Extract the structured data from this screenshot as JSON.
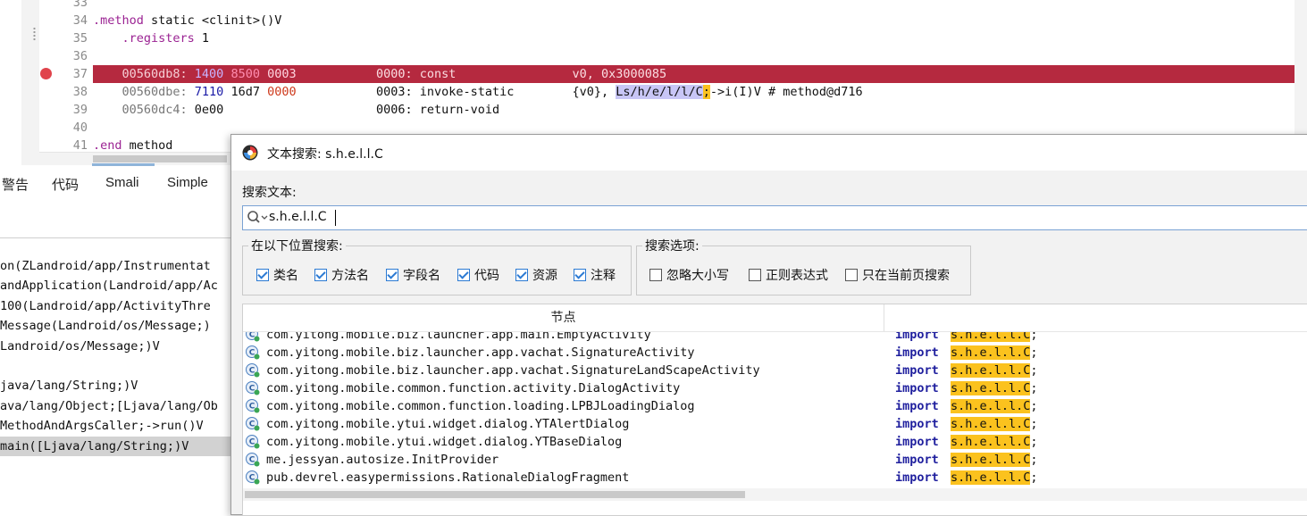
{
  "editor": {
    "lines": [
      {
        "num": "33",
        "parts": []
      },
      {
        "num": "34",
        "parts": [
          {
            "t": ".method",
            "c": "kw"
          },
          {
            "t": " static <clinit>()V",
            "c": ""
          }
        ]
      },
      {
        "num": "35",
        "parts": [
          {
            "t": "    .registers",
            "c": "kw"
          },
          {
            "t": " 1",
            "c": ""
          }
        ]
      },
      {
        "num": "36",
        "parts": []
      },
      {
        "num": "37",
        "highlight": true,
        "parts": [
          {
            "t": "    00560db8: ",
            "c": "addr"
          },
          {
            "t": "1400",
            "c": "hx1"
          },
          {
            "t": " ",
            "c": ""
          },
          {
            "t": "8500",
            "c": "hx2"
          },
          {
            "t": " ",
            "c": ""
          },
          {
            "t": "0003",
            "c": "hx3"
          },
          {
            "t": "           0000: const                v0, 0x3000085",
            "c": ""
          }
        ]
      },
      {
        "num": "38",
        "parts": [
          {
            "t": "    00560dbe: ",
            "c": "addr"
          },
          {
            "t": "7110",
            "c": "hx1"
          },
          {
            "t": " 16d7 ",
            "c": ""
          },
          {
            "t": "0000",
            "c": "hx2"
          },
          {
            "t": "           0003: invoke-static        {v0}, ",
            "c": ""
          },
          {
            "t": "Ls/h/e/l/l/C",
            "c": "mark-purple"
          },
          {
            "t": ";",
            "c": "mark-yellow"
          },
          {
            "t": "->i(I)V # method@d716",
            "c": ""
          }
        ]
      },
      {
        "num": "39",
        "parts": [
          {
            "t": "    00560dc4: ",
            "c": "addr"
          },
          {
            "t": "0e00",
            "c": ""
          },
          {
            "t": "                     0006: return-void",
            "c": ""
          }
        ]
      },
      {
        "num": "40",
        "parts": []
      },
      {
        "num": "41",
        "parts": [
          {
            "t": ".end",
            "c": "kw"
          },
          {
            "t": " method",
            "c": ""
          }
        ]
      }
    ]
  },
  "tabs": [
    "警告",
    "代码",
    "Smali",
    "Simple"
  ],
  "stack_lines": [
    "on(ZLandroid/app/Instrumentat",
    "andApplication(Landroid/app/Ac",
    "100(Landroid/app/ActivityThre",
    "Message(Landroid/os/Message;)",
    "Landroid/os/Message;)V",
    "",
    "java/lang/String;)V",
    "ava/lang/Object;[Ljava/lang/Ob",
    "MethodAndArgsCaller;->run()V",
    "main([Ljava/lang/String;)V"
  ],
  "dialog": {
    "title": "文本搜索: s.h.e.l.l.C",
    "search_label": "搜索文本:",
    "search_value": "s.h.e.l.l.C",
    "where_group_title": "在以下位置搜索:",
    "where_options": [
      {
        "label": "类名",
        "checked": true
      },
      {
        "label": "方法名",
        "checked": true
      },
      {
        "label": "字段名",
        "checked": true
      },
      {
        "label": "代码",
        "checked": true
      },
      {
        "label": "资源",
        "checked": true
      },
      {
        "label": "注释",
        "checked": true
      }
    ],
    "options_group_title": "搜索选项:",
    "search_options": [
      {
        "label": "忽略大小写",
        "checked": false
      },
      {
        "label": "正则表达式",
        "checked": false
      },
      {
        "label": "只在当前页搜索",
        "checked": false
      }
    ],
    "results": {
      "column_node": "节点",
      "rows": [
        {
          "node": "com.yitong.mobile.biz.launcher.app.main.EmptyActivity",
          "kw": "import",
          "match": "s.h.e.l.l.C",
          "tail": ";"
        },
        {
          "node": "com.yitong.mobile.biz.launcher.app.vachat.SignatureActivity",
          "kw": "import",
          "match": "s.h.e.l.l.C",
          "tail": ";"
        },
        {
          "node": "com.yitong.mobile.biz.launcher.app.vachat.SignatureLandScapeActivity",
          "kw": "import",
          "match": "s.h.e.l.l.C",
          "tail": ";"
        },
        {
          "node": "com.yitong.mobile.common.function.activity.DialogActivity",
          "kw": "import",
          "match": "s.h.e.l.l.C",
          "tail": ";"
        },
        {
          "node": "com.yitong.mobile.common.function.loading.LPBJLoadingDialog",
          "kw": "import",
          "match": "s.h.e.l.l.C",
          "tail": ";"
        },
        {
          "node": "com.yitong.mobile.ytui.widget.dialog.YTAlertDialog",
          "kw": "import",
          "match": "s.h.e.l.l.C",
          "tail": ";"
        },
        {
          "node": "com.yitong.mobile.ytui.widget.dialog.YTBaseDialog",
          "kw": "import",
          "match": "s.h.e.l.l.C",
          "tail": ";"
        },
        {
          "node": "me.jessyan.autosize.InitProvider",
          "kw": "import",
          "match": "s.h.e.l.l.C",
          "tail": ";"
        },
        {
          "node": "pub.devrel.easypermissions.RationaleDialogFragment",
          "kw": "import",
          "match": "s.h.e.l.l.C",
          "tail": ";"
        }
      ]
    }
  },
  "colors": {
    "breakpoint_row": "#b5293f",
    "match_highlight": "#fbc21e",
    "keyword_blue": "#1f1f9e",
    "checkbox_blue": "#2c7ad3"
  },
  "icons": {
    "breakpoint": "breakpoint-dot-icon",
    "app_logo": "jadx-logo-icon",
    "search": "search-icon",
    "class": "class-icon"
  }
}
